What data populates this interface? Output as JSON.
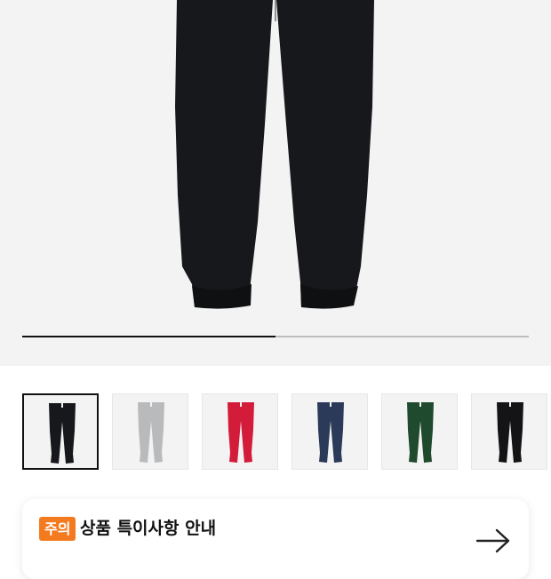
{
  "gallery": {
    "current_slide_fraction": 0.5,
    "main_color": "#17181b"
  },
  "thumbnails": [
    {
      "color": "#17181b",
      "icon": "pants-icon",
      "selected": true
    },
    {
      "color": "#b9babc",
      "icon": "pants-icon",
      "selected": false
    },
    {
      "color": "#d21c3a",
      "icon": "pants-icon",
      "selected": false
    },
    {
      "color": "#2c3a5a",
      "icon": "pants-icon",
      "selected": false
    },
    {
      "color": "#1f4a2e",
      "icon": "pants-icon",
      "selected": false
    },
    {
      "color": "#141416",
      "icon": "pants-icon",
      "selected": false
    }
  ],
  "notice": {
    "badge": "주의",
    "title": "상품 특이사항 안내",
    "subtitle": "",
    "arrow_icon": "arrow-right-icon",
    "accent": "#f47a20"
  }
}
